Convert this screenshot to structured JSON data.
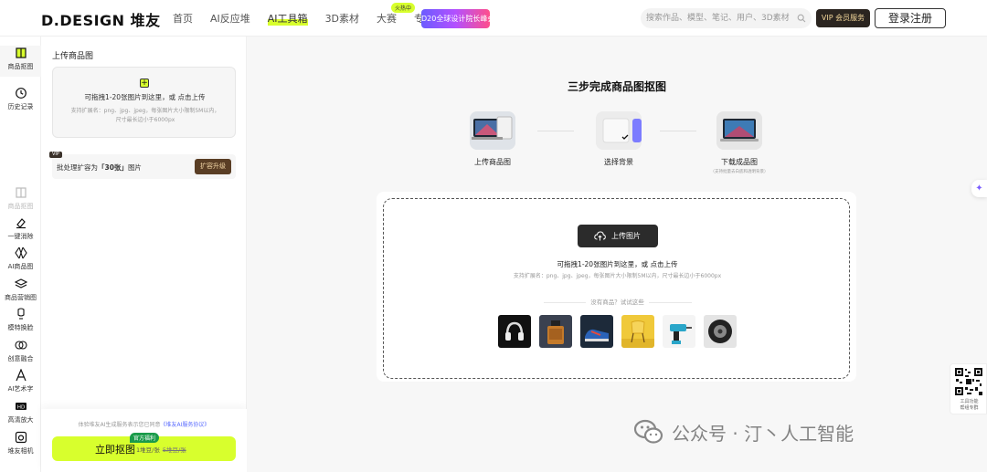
{
  "header": {
    "logo": "D.DESIGN 堆友",
    "nav": [
      {
        "label": "首页"
      },
      {
        "label": "AI反应堆"
      },
      {
        "label": "AI工具箱"
      },
      {
        "label": "3D素材"
      },
      {
        "label": "大赛"
      },
      {
        "label": "专家营"
      }
    ],
    "promo_tag": "火热中",
    "promo_label": "D20全球设计院长峰会",
    "search_placeholder": "搜索作品、模型、笔记、用户、3D素材",
    "vip_label": "VIP 会员服务",
    "login_label": "登录注册"
  },
  "rail": [
    {
      "label": "商品抠图",
      "icon": "product-cutout-icon"
    },
    {
      "label": "历史记录",
      "icon": "history-clock-icon"
    },
    {
      "label": "商品抠图",
      "icon": "product-cutout-icon"
    },
    {
      "label": "一键消除",
      "icon": "eraser-icon"
    },
    {
      "label": "AI商品图",
      "icon": "ai-product-icon"
    },
    {
      "label": "商品营销图",
      "icon": "layers-icon"
    },
    {
      "label": "模特换脸",
      "icon": "model-face-icon"
    },
    {
      "label": "创意融合",
      "icon": "fusion-icon"
    },
    {
      "label": "AI艺术字",
      "icon": "art-text-icon"
    },
    {
      "label": "高清放大",
      "icon": "hd-upscale-icon"
    },
    {
      "label": "堆友相机",
      "icon": "camera-icon"
    }
  ],
  "panel": {
    "title": "上传商品图",
    "drop_main": "可拖拽1-20张图片到这里，或 点击上传",
    "drop_sub": "支持扩展名：png、jpg、jpeg，每张图片大小限制5M以内，尺寸最长边小于6000px",
    "vip_badge": "VIP",
    "batch_prefix": "批处理扩容为",
    "batch_count": "「30张」",
    "batch_suffix": "图片",
    "upgrade_label": "扩容升级",
    "agreement_prefix": "体验堆友AI生成服务表示您已同意",
    "agreement_link": "《堆友AI服务协议》",
    "go_label": "立即抠图",
    "go_badge": "官方福利",
    "go_cost": "1堆豆/张",
    "go_cost_old": "5堆豆/张"
  },
  "main": {
    "steps_title": "三步完成商品图抠图",
    "steps": [
      {
        "label": "上传商品图"
      },
      {
        "label": "选择背景"
      },
      {
        "label": "下载成品图",
        "sub": "（支持批量去白底和透明背景）"
      }
    ],
    "upload_button": "上传图片",
    "upload_main": "可拖拽1-20张图片到这里，或 点击上传",
    "upload_sub": "支持扩展名：png、jpg、jpeg，每张图片大小限制5M以内，尺寸最长边小于6000px",
    "try_text": "没有商品？试试这些",
    "samples": [
      {
        "name": "headphones"
      },
      {
        "name": "perfume"
      },
      {
        "name": "sneaker"
      },
      {
        "name": "chair"
      },
      {
        "name": "drill"
      },
      {
        "name": "tire"
      }
    ]
  },
  "side": {
    "qr_text_line1": "工具功能",
    "qr_text_line2": "帮组专群"
  },
  "watermark": "公众号 · 汀丶人工智能",
  "colors": {
    "accent": "#d8ff2d",
    "dark": "#2b2b2b",
    "vip_gold": "#f3d79b",
    "link": "#5a6cff"
  }
}
